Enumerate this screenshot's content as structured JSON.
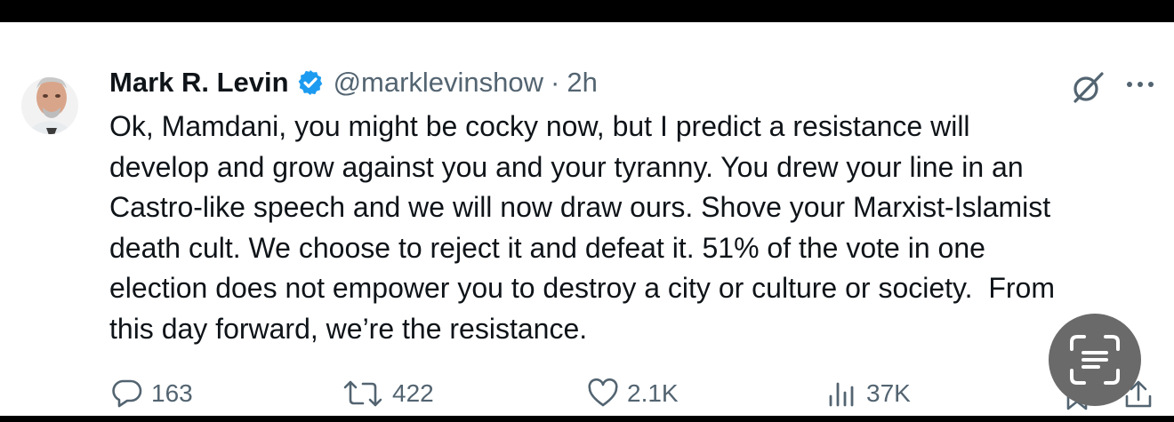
{
  "tweet": {
    "author_name": "Mark R. Levin",
    "handle": "@marklevinshow",
    "separator": "·",
    "time": "2h",
    "text": "Ok, Mamdani, you might be cocky now, but I predict a resistance will\ndevelop and grow against you and your tyranny. You drew your line in an\nCastro-like speech and we will now draw ours. Shove your Marxist-Islamist\ndeath cult. We choose to reject it and defeat it. 51% of the vote in one\nelection does not empower you to destroy a city or culture or society.  From\nthis day forward, we’re the resistance."
  },
  "actions": {
    "replies": "163",
    "reposts": "422",
    "likes": "2.1K",
    "views": "37K"
  },
  "icons": [
    "verified-badge-icon",
    "grok-icon",
    "more-icon",
    "reply-icon",
    "repost-icon",
    "like-icon",
    "views-icon",
    "bookmark-icon",
    "share-icon",
    "text-scan-icon"
  ],
  "colors": {
    "verified": "#1d9bf0",
    "text": "#0f1419",
    "secondary": "#536471"
  }
}
